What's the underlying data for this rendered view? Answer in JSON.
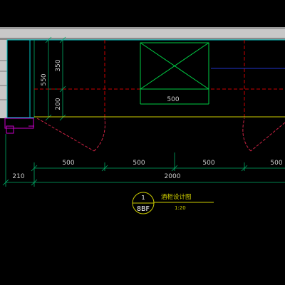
{
  "dimensions": {
    "top_box_width": "500",
    "vertical_550": "550",
    "vertical_350": "350",
    "vertical_200": "200",
    "segment_1": "500",
    "segment_2": "500",
    "segment_3": "500",
    "segment_4": "500",
    "left_offset": "210",
    "overall": "2000"
  },
  "title_block": {
    "detail_number": "1",
    "sheet_ref": "8BF",
    "title": "酒柜设计图",
    "scale": "1:20"
  },
  "colors": {
    "background": "#000000",
    "wall": "#c0c0c0",
    "cabinet_outline": "#00cccc",
    "dimension_lines": "#00aa66",
    "hidden_lines": "#cc0000",
    "door_swing": "#cc2244",
    "counter_line": "#cccc00",
    "title_circle": "#cccc00",
    "accent_blue": "#2233cc",
    "magenta": "#cc00cc"
  }
}
